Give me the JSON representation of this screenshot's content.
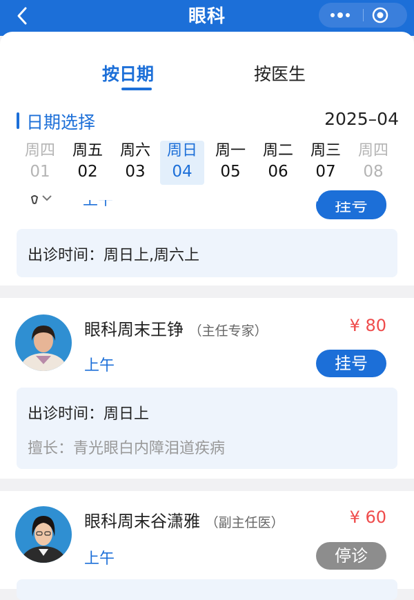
{
  "header": {
    "title": "眼科"
  },
  "tabs": [
    {
      "label": "按日期",
      "active": true
    },
    {
      "label": "按医生",
      "active": false
    }
  ],
  "date_section": {
    "title": "日期选择",
    "month": "2025–04"
  },
  "days": [
    {
      "name": "周四",
      "num": "01",
      "state": "disabled"
    },
    {
      "name": "周五",
      "num": "02",
      "state": "normal"
    },
    {
      "name": "周六",
      "num": "03",
      "state": "normal"
    },
    {
      "name": "周日",
      "num": "04",
      "state": "selected"
    },
    {
      "name": "周一",
      "num": "05",
      "state": "normal"
    },
    {
      "name": "周二",
      "num": "06",
      "state": "normal"
    },
    {
      "name": "周三",
      "num": "07",
      "state": "normal"
    },
    {
      "name": "周四",
      "num": "08",
      "state": "disabled"
    }
  ],
  "partial_card": {
    "session": "上午",
    "button": "挂号",
    "schedule": "出诊时间：周日上,周六上"
  },
  "doctors": [
    {
      "name": "眼科周末王铮",
      "title": "（主任专家）",
      "price": "¥ 80",
      "session": "上午",
      "button": "挂号",
      "button_state": "available",
      "schedule": "出诊时间：周日上",
      "specialty": "擅长：青光眼白内障泪道疾病"
    },
    {
      "name": "眼科周末谷潇雅",
      "title": "（副主任医）",
      "price": "¥ 60",
      "session": "上午",
      "button": "停诊",
      "button_state": "suspended"
    }
  ],
  "colors": {
    "accent": "#1c6fd8",
    "price": "#ef4b4b",
    "suspended": "#8d8d8d",
    "info_bg": "#eef4fc"
  },
  "icons": [
    "back-arrow-icon",
    "more-dots-icon",
    "close-target-icon"
  ]
}
